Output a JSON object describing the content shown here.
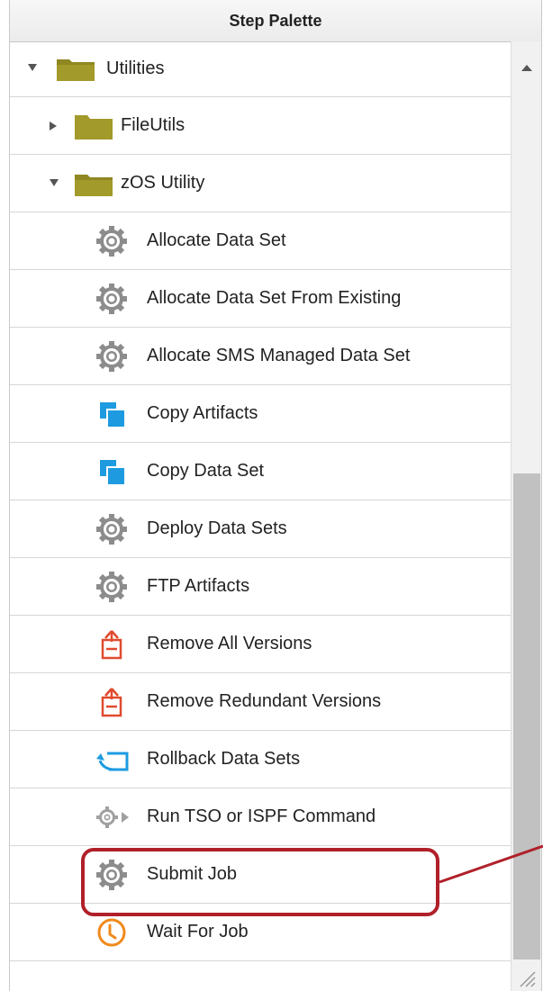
{
  "panel": {
    "title": "Step Palette"
  },
  "items": [
    {
      "label": "Utilities",
      "kind": "folder",
      "level": 0,
      "expanded": true
    },
    {
      "label": "FileUtils",
      "kind": "folder",
      "level": 1,
      "expanded": false
    },
    {
      "label": "zOS Utility",
      "kind": "folder",
      "level": 1,
      "expanded": true
    },
    {
      "label": "Allocate Data Set",
      "kind": "gear-icon",
      "level": 2
    },
    {
      "label": "Allocate Data Set From Existing",
      "kind": "gear-icon",
      "level": 2
    },
    {
      "label": "Allocate SMS Managed Data Set",
      "kind": "gear-icon",
      "level": 2
    },
    {
      "label": "Copy Artifacts",
      "kind": "copy-icon",
      "level": 2
    },
    {
      "label": "Copy Data Set",
      "kind": "copy-icon",
      "level": 2
    },
    {
      "label": "Deploy Data Sets",
      "kind": "gear-icon",
      "level": 2
    },
    {
      "label": "FTP Artifacts",
      "kind": "gear-icon",
      "level": 2
    },
    {
      "label": "Remove All Versions",
      "kind": "remove-icon",
      "level": 2
    },
    {
      "label": "Remove Redundant Versions",
      "kind": "remove-icon",
      "level": 2
    },
    {
      "label": "Rollback Data Sets",
      "kind": "rollback-icon",
      "level": 2
    },
    {
      "label": "Run TSO or ISPF Command",
      "kind": "gear-run-icon",
      "level": 2
    },
    {
      "label": "Submit Job",
      "kind": "gear-icon",
      "level": 2
    },
    {
      "label": "Wait For Job",
      "kind": "clock-icon",
      "level": 2
    }
  ],
  "colors": {
    "folder": "#a29a2a",
    "gear": "#8c8c8c",
    "copy": "#1e9be0",
    "remove": "#e04a2e",
    "clock": "#f08a1c",
    "highlight": "#b0202a"
  }
}
